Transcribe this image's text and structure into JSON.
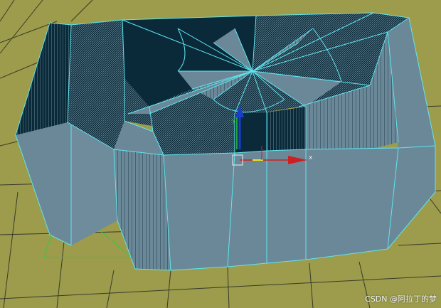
{
  "viewport": {
    "background_color": "#9c9c4c",
    "grid_line_color": "#3a3a28",
    "wireframe_color": "#5fe6f0",
    "surface_color": "#6a8898",
    "surface_light_color": "#7a97a6",
    "interior_dark_color": "#0a2a3a",
    "bounding_box_color": "#2ecc40"
  },
  "gizmo": {
    "x_axis_label": "x",
    "y_axis_label": "y",
    "x_axis_color": "#cc2020",
    "y_axis_color": "#2ecc40",
    "z_axis_color": "#1a3dd0",
    "center_color": "#f0e020",
    "icon": "transform-gizmo-icon"
  },
  "watermark": {
    "text": "CSDN @阿拉丁的梦"
  }
}
